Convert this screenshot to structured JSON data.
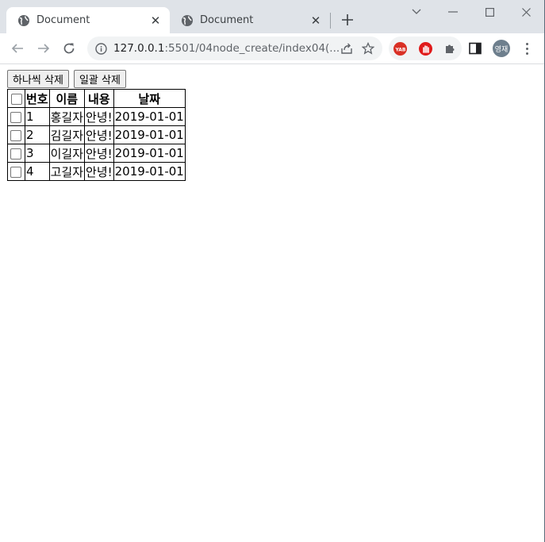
{
  "browser": {
    "tabs": [
      {
        "title": "Document",
        "active": true
      },
      {
        "title": "Document",
        "active": false
      }
    ],
    "url_host": "127.0.0.1",
    "url_rest": ":5501/04node_create/index04(...",
    "profile_initials": "영재",
    "extensions": [
      "yab-extension-icon",
      "adblock-hand-icon",
      "puzzle-extensions-icon"
    ]
  },
  "page": {
    "buttons": {
      "delete_one": "하나씩 삭제",
      "delete_all": "일괄 삭제"
    },
    "table": {
      "headers": [
        "번호",
        "이름",
        "내용",
        "날짜"
      ],
      "rows": [
        [
          "1",
          "홍길자",
          "안녕!",
          "2019-01-01"
        ],
        [
          "2",
          "김길자",
          "안녕!",
          "2019-01-01"
        ],
        [
          "3",
          "이길자",
          "안녕!",
          "2019-01-01"
        ],
        [
          "4",
          "고길자",
          "안녕!",
          "2019-01-01"
        ]
      ]
    }
  }
}
